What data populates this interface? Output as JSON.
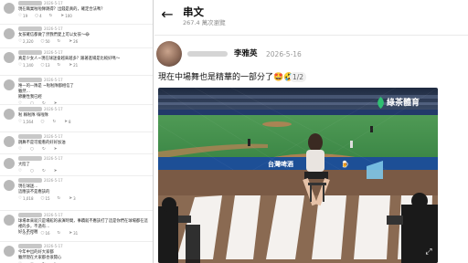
{
  "comments_panel": {
    "comments": [
      {
        "time": "2026-5-17",
        "text": "現在職業啦啦隊跳得？出錢是真的，確定合法嗎？",
        "likes": "19",
        "replies": "4",
        "reposts": "",
        "shares": "100"
      },
      {
        "time": "2026-5-17",
        "text": "女孩確信都做了然我們愛上可以女孩～😂",
        "likes": "2,320",
        "replies": "50",
        "reposts": "",
        "shares": "26"
      },
      {
        "time": "2026-5-17",
        "text": "真是少女人~現在球迷會越來越多？跟著進場是比較好嗎～",
        "likes": "1,140",
        "replies": "13",
        "reposts": "",
        "shares": "21"
      },
      {
        "time": "2026-5-17",
        "text": "唯一的一隊是 ~啦啦隊都相信了\n雖然…\n節慶性我已經",
        "likes": "",
        "replies": "",
        "reposts": "",
        "shares": ""
      },
      {
        "time": "2026-5-17",
        "text": "啦 賴啦隊 嗨啦隊",
        "likes": "1,564",
        "replies": "",
        "reposts": "",
        "shares": "8"
      },
      {
        "time": "2026-5-17",
        "text": "跳舞不是可能看的好好加油",
        "likes": "",
        "replies": "",
        "reposts": "",
        "shares": ""
      },
      {
        "time": "2026-5-17",
        "text": "大陸了",
        "likes": "",
        "replies": "",
        "reposts": "",
        "shares": ""
      },
      {
        "time": "2026-5-17",
        "text": "現在球迷…\n這應該不是應該的",
        "likes": "1,018",
        "replies": "15",
        "reposts": "",
        "shares": "3"
      },
      {
        "time": "2026-5-17",
        "text": "球場本來就只是場館的表演時間，事蹟就不應該打了這是你們在球場都在這裡的多，不過有…\n好久不見喔",
        "likes": "3,071",
        "replies": "16",
        "reposts": "",
        "shares": "31"
      },
      {
        "time": "2026-5-17",
        "text": "今年中出的好大家都\n雖然現在大家都也很開心",
        "likes": "",
        "replies": "",
        "reposts": "",
        "shares": ""
      }
    ]
  },
  "post_panel": {
    "header": {
      "title": "串文",
      "views": "267.4 萬次瀏覽"
    },
    "post": {
      "author": "李雅英",
      "date": "2026-5-16",
      "caption": "現在中場舞也是精華的一部分了🤩🤣",
      "page_indicator": "1/2",
      "image": {
        "watermark": "綠茶體育",
        "banner_text": "",
        "colors": {
          "field_green": "#3f8f4a",
          "infield_dirt": "#b9774d",
          "stands": "#2a3a55",
          "dugout_wall": "#6a4e3a",
          "logo_text": "#ffffff"
        }
      }
    }
  },
  "icons": {
    "back": "arrow-left-icon",
    "like": "heart-icon",
    "reply": "comment-icon",
    "repost": "repost-icon",
    "share": "share-icon",
    "expand": "expand-icon"
  }
}
